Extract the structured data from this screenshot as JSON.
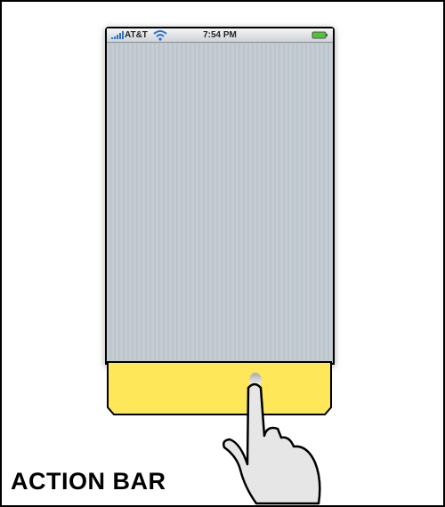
{
  "status_bar": {
    "carrier": "AT&T",
    "time": "7:54 PM",
    "icons": [
      "signal-icon",
      "wifi-icon",
      "battery-icon"
    ],
    "battery_color": "#4fc33a"
  },
  "action_bar": {
    "color": "#fee85a"
  },
  "caption": "ACTION BAR"
}
